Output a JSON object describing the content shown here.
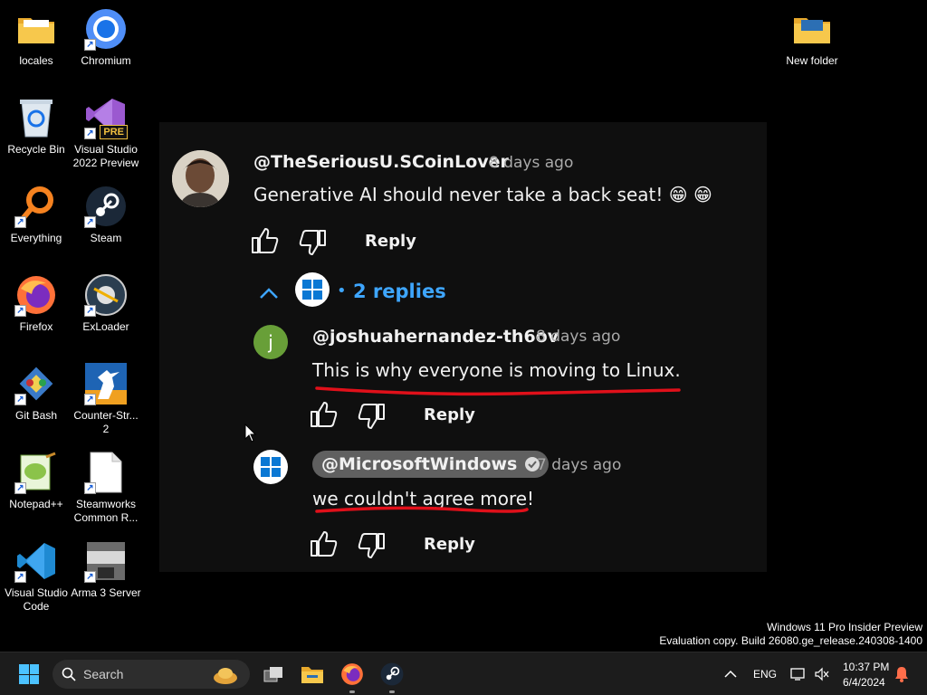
{
  "desktop": {
    "icons": [
      {
        "label": "locales"
      },
      {
        "label": "Chromium"
      },
      {
        "label": "Recycle Bin"
      },
      {
        "label": "Visual Studio 2022 Preview"
      },
      {
        "label": "Everything"
      },
      {
        "label": "Steam"
      },
      {
        "label": "Firefox"
      },
      {
        "label": "ExLoader"
      },
      {
        "label": "Git Bash"
      },
      {
        "label": "Counter-Str... 2"
      },
      {
        "label": "Notepad++"
      },
      {
        "label": "Steamworks Common R..."
      },
      {
        "label": "Visual Studio Code"
      },
      {
        "label": "Arma 3 Server"
      },
      {
        "label": "New folder"
      }
    ],
    "vs_badge": "PRE"
  },
  "comments": {
    "top": {
      "author": "@TheSeriousU.SCoinLover",
      "time": "8 days ago",
      "text": "Generative AI should never take a back seat! 😁 😁",
      "reply_label": "Reply"
    },
    "replies_toggle": {
      "bullet": "•",
      "label": "2 replies"
    },
    "reply1": {
      "avatar_letter": "j",
      "author": "@joshuahernandez-th6ov",
      "time": "8 days ago",
      "text": "This is why everyone is moving to Linux.",
      "reply_label": "Reply"
    },
    "reply2": {
      "author": "@MicrosoftWindows",
      "time": "7 days ago",
      "text": "we couldn't agree more!",
      "reply_label": "Reply"
    },
    "colors": {
      "accent_blue": "#3ea6ff",
      "annotation_red": "#e0101a",
      "reply1_avatar": "#689f38"
    }
  },
  "watermark": {
    "line1": "Windows 11 Pro Insider Preview",
    "line2": "Evaluation copy. Build 26080.ge_release.240308-1400"
  },
  "taskbar": {
    "search_placeholder": "Search",
    "language": "ENG",
    "time": "10:37 PM",
    "date": "6/4/2024"
  }
}
